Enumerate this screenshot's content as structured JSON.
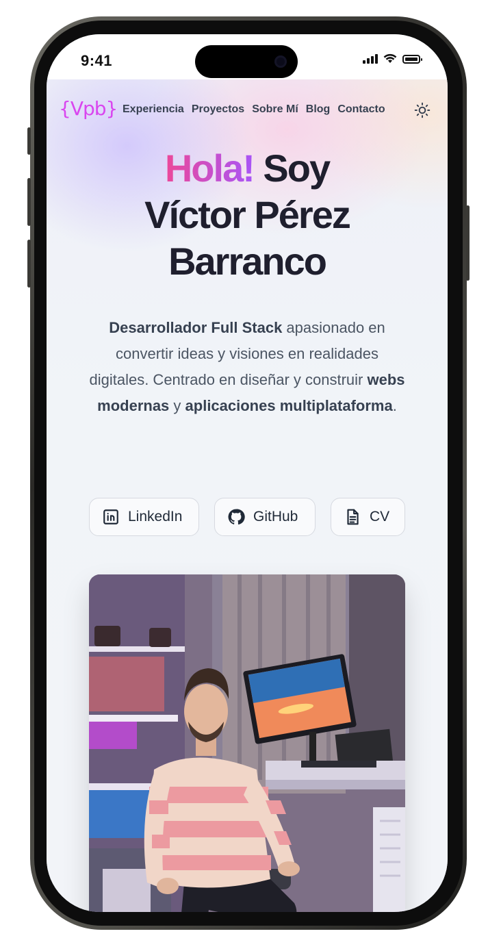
{
  "status_bar": {
    "time": "9:41"
  },
  "nav": {
    "logo": "{Vpb}",
    "links": [
      "Experiencia",
      "Proyectos",
      "Sobre Mí",
      "Blog",
      "Contacto"
    ],
    "theme_toggle_icon": "sun-icon"
  },
  "hero": {
    "greeting": "Hola!",
    "title_rest_line1": " Soy",
    "title_line2": "Víctor Pérez",
    "title_line3": "Barranco",
    "intro": {
      "role": "Desarrollador Full Stack",
      "part1": " apasionado en convertir ideas y visiones en realidades digitales. Centrado en diseñar y construir ",
      "webs": "webs modernas",
      "and": " y ",
      "apps": "aplicaciones multiplataforma",
      "end": "."
    }
  },
  "social": [
    {
      "label": "LinkedIn",
      "icon": "linkedin-icon"
    },
    {
      "label": "GitHub",
      "icon": "github-icon"
    },
    {
      "label": "CV",
      "icon": "document-icon"
    }
  ],
  "colors": {
    "accent_pink": "#ec4899",
    "accent_purple": "#a855f7",
    "logo": "#d946ef",
    "text_dark": "#1f1f2e"
  }
}
